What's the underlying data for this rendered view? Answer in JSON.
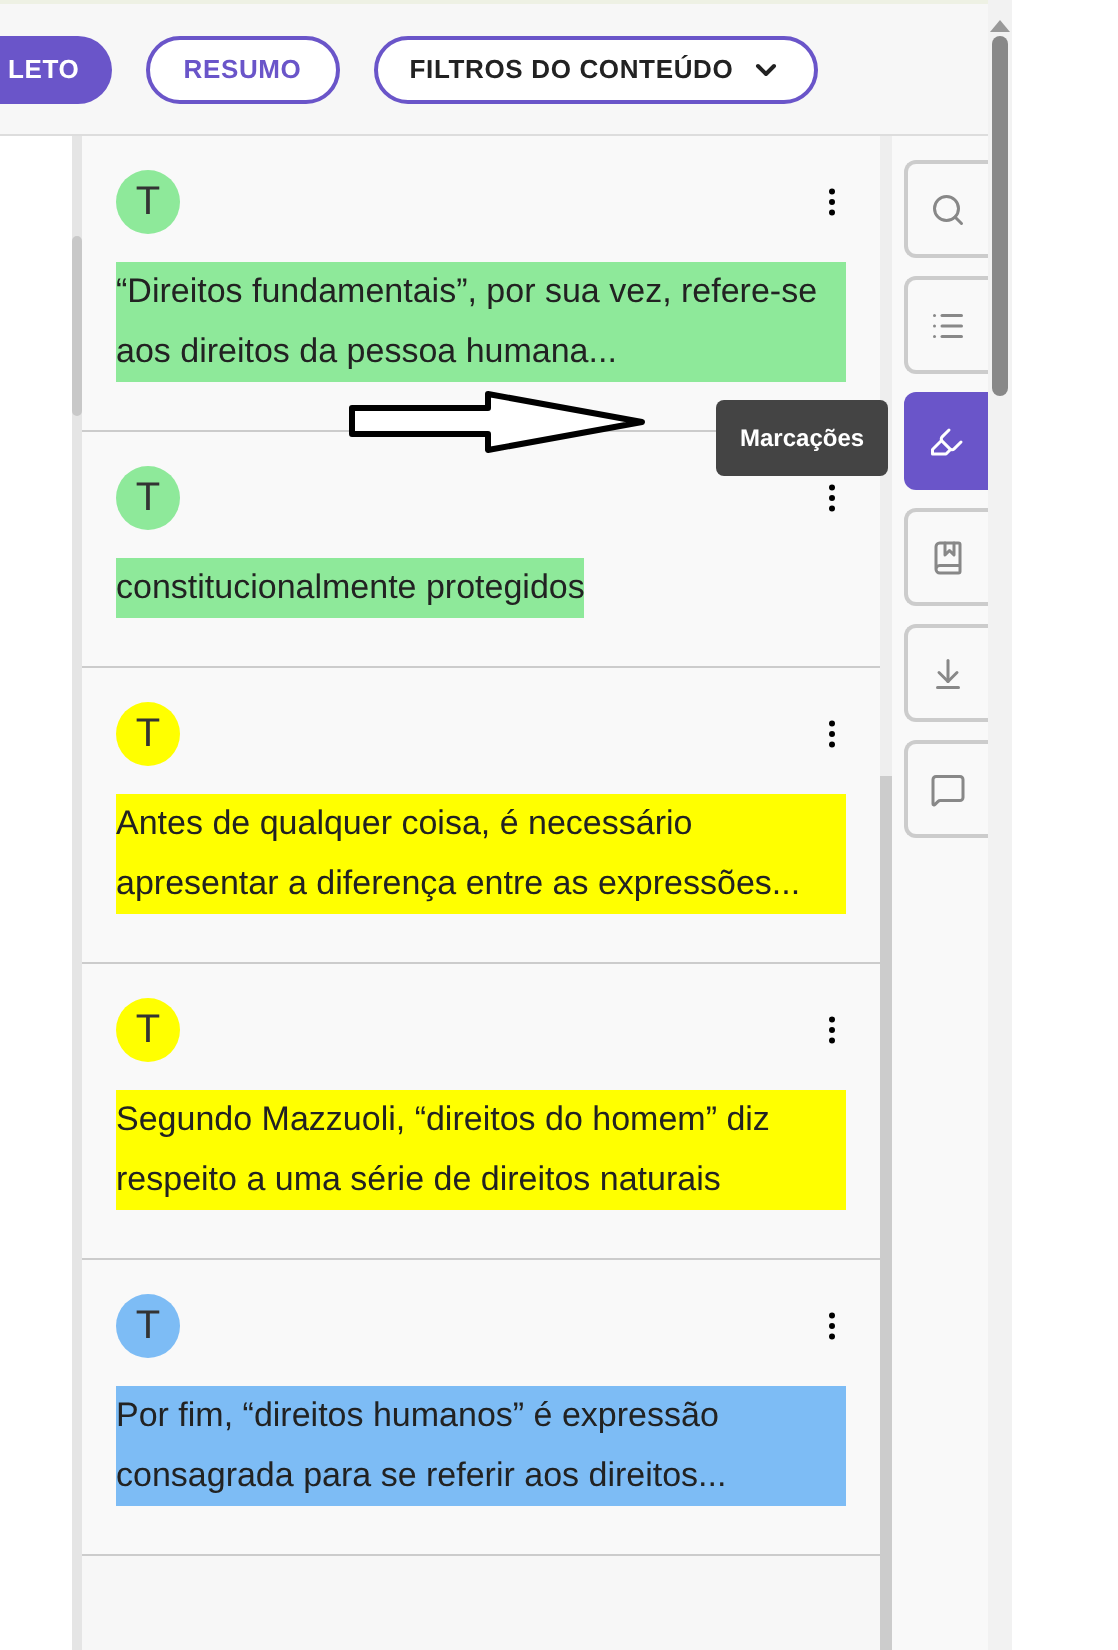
{
  "toolbar": {
    "buttons": [
      {
        "label": "LETO",
        "kind": "filled"
      },
      {
        "label": "RESUMO",
        "kind": "outline"
      },
      {
        "label": "FILTROS DO CONTEÚDO",
        "kind": "dropdown"
      }
    ]
  },
  "highlights": [
    {
      "avatar": "T",
      "color": "#8ee99a",
      "text": "“Direitos fundamentais”, por sua vez, refere-se aos direitos da pessoa humana..."
    },
    {
      "avatar": "T",
      "color": "#8ee99a",
      "text": "constitucionalmente protegidos"
    },
    {
      "avatar": "T",
      "color": "#ffff00",
      "text": "Antes de qualquer coisa, é necessário apresentar a diferença entre as expressões..."
    },
    {
      "avatar": "T",
      "color": "#ffff00",
      "text": "Segundo Mazzuoli, “direitos do homem” diz respeito a uma série de direitos naturais"
    },
    {
      "avatar": "T",
      "color": "#7dbcf5",
      "text": "Por fim, “direitos humanos” é expressão consagrada para se referir aos direitos..."
    }
  ],
  "side_tools": [
    {
      "kind": "search",
      "selected": false
    },
    {
      "kind": "list",
      "selected": false
    },
    {
      "kind": "marker",
      "selected": true
    },
    {
      "kind": "bookmark",
      "selected": false
    },
    {
      "kind": "download",
      "selected": false
    },
    {
      "kind": "comment",
      "selected": false
    }
  ],
  "tooltip": "Marcações"
}
